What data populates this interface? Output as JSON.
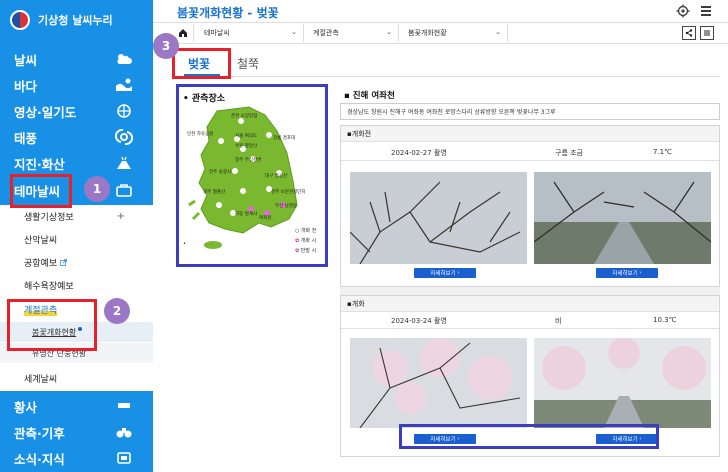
{
  "sidebar": {
    "logo_text": "기상청 날씨누리",
    "nav": [
      {
        "label": "날씨",
        "icon": "cloud-sun-icon"
      },
      {
        "label": "바다",
        "icon": "wave-icon"
      },
      {
        "label": "영상·일기도",
        "icon": "globe-icon"
      },
      {
        "label": "태풍",
        "icon": "typhoon-icon"
      },
      {
        "label": "지진·화산",
        "icon": "volcano-icon"
      },
      {
        "label": "테마날씨",
        "icon": "briefcase-icon"
      }
    ],
    "sub_items": [
      {
        "label": "생활기상정보",
        "has_plus": "+"
      },
      {
        "label": "산악날씨"
      },
      {
        "label": "공항예보"
      },
      {
        "label": "해수욕장예보"
      },
      {
        "label": "계절관측"
      }
    ],
    "sub_sub_items": [
      {
        "label": "봄꽃개화현황",
        "active": true
      },
      {
        "label": "유명산 단풍현황"
      }
    ],
    "world_weather": "세계날씨",
    "nav_bottom": [
      {
        "label": "황사",
        "icon": "dust-icon"
      },
      {
        "label": "관측·기후",
        "icon": "binoculars-icon"
      },
      {
        "label": "소식·지식",
        "icon": "news-icon"
      }
    ]
  },
  "badges": [
    "1",
    "2",
    "3"
  ],
  "header": {
    "title": "봄꽃개화현황 - 벚꽃",
    "breadcrumb": [
      "테마날씨",
      "계절관측",
      "봄꽃개화현황"
    ]
  },
  "tabs": [
    "벚꽃",
    "철쭉"
  ],
  "map": {
    "title": "관측장소",
    "labels": [
      "춘천 소양강댐",
      "인천 자유공원",
      "서울 여의도",
      "수원 팔달산",
      "청주 무심천변",
      "강릉 경포대",
      "전주 송광사",
      "대구 팔공산",
      "광주 월출산",
      "경주 보문관광단지",
      "부산 남천동",
      "하동 쌍계사",
      "여좌천"
    ],
    "legend": [
      "개화 전",
      "개화 시",
      "만발 시"
    ]
  },
  "location": {
    "title": "진해 여좌천",
    "desc": "경상남도 창원시 진해구 여좌동 여좌천 로망스다리 상류방향 오른쪽 벚꽃나무 3그루"
  },
  "sections": [
    {
      "head": "개화전",
      "date": "2024-02-27 촬영",
      "weather": "구름 조금",
      "temp": "7.1℃",
      "btn": "자세히보기"
    },
    {
      "head": "개화",
      "date": "2024-03-24 촬영",
      "weather": "비",
      "temp": "10.3℃",
      "btn": "자세히보기"
    }
  ],
  "colors": {
    "sidebar": "#1890e6",
    "accent": "#1a75cf",
    "annotation_red": "#e8202a",
    "annotation_blue": "#3b3ec2",
    "badge": "#9b78c5"
  }
}
